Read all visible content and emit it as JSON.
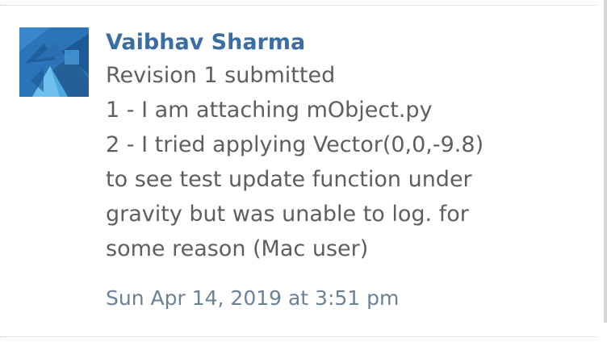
{
  "comment": {
    "avatar_icon": "blue-triangle-pattern-avatar-icon",
    "author": "Vaibhav Sharma",
    "lines": [
      "Revision 1 submitted",
      "1 - I am attaching mObject.py",
      "2 - I tried applying Vector(0,0,-9.8)",
      "to see test update function under",
      "gravity but was unable to log. for",
      "some reason (Mac user)"
    ],
    "timestamp": "Sun Apr 14, 2019 at 3:51 pm"
  },
  "colors": {
    "author": "#3b6da3",
    "body_text": "#5e5e5e",
    "timestamp": "#6b8198",
    "avatar_bg": "#2c74b8"
  }
}
